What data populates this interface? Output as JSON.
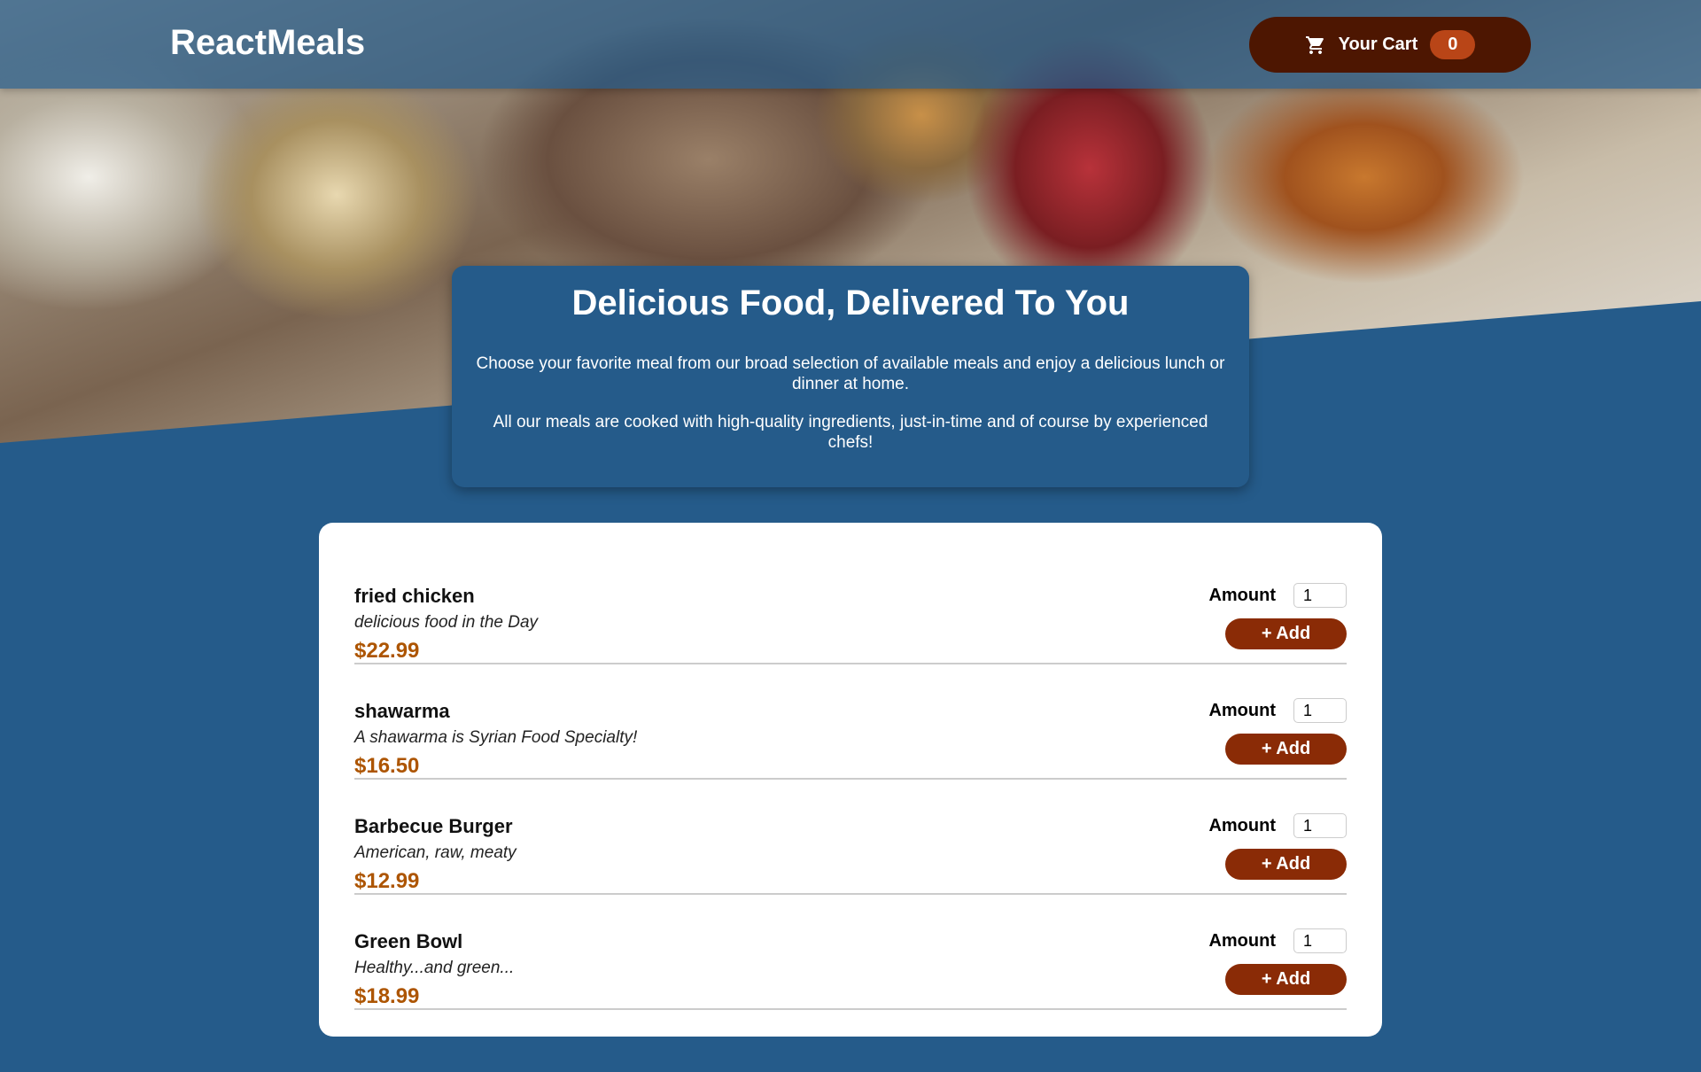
{
  "header": {
    "title": "ReactMeals",
    "cart_label": "Your Cart",
    "cart_count": "0"
  },
  "summary": {
    "title": "Delicious Food, Delivered To You",
    "p1": "Choose your favorite meal from our broad selection of available meals and enjoy a delicious lunch or dinner at home.",
    "p2": "All our meals are cooked with high-quality ingredients, just-in-time and of course by experienced chefs!"
  },
  "meals": [
    {
      "name": "fried chicken",
      "description": "delicious food in the Day",
      "price": "$22.99",
      "amount_label": "Amount",
      "amount": "1",
      "add_label": "+ Add"
    },
    {
      "name": "shawarma",
      "description": "A shawarma is Syrian Food Specialty!",
      "price": "$16.50",
      "amount_label": "Amount",
      "amount": "1",
      "add_label": "+ Add"
    },
    {
      "name": "Barbecue Burger",
      "description": "American, raw, meaty",
      "price": "$12.99",
      "amount_label": "Amount",
      "amount": "1",
      "add_label": "+ Add"
    },
    {
      "name": "Green Bowl",
      "description": "Healthy...and green...",
      "price": "$18.99",
      "amount_label": "Amount",
      "amount": "1",
      "add_label": "+ Add"
    }
  ]
}
